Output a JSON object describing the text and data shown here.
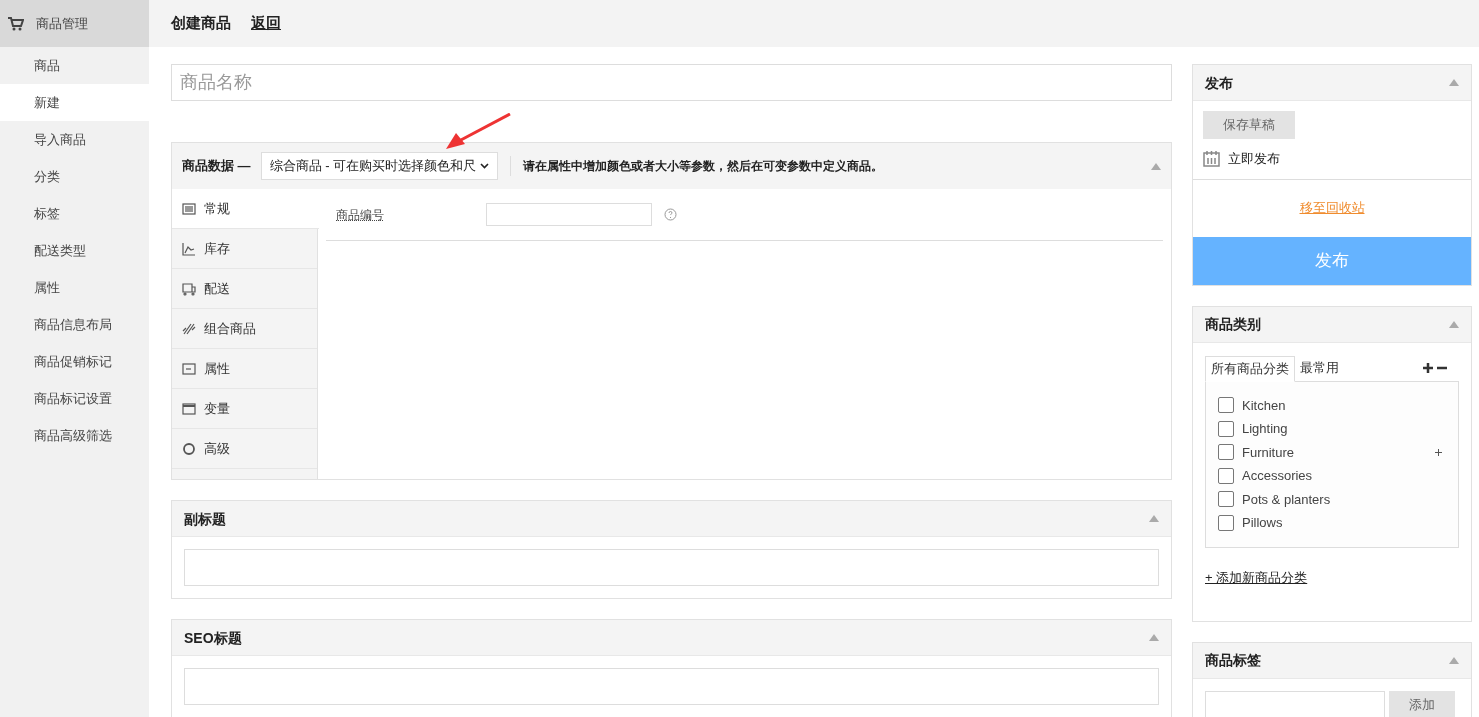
{
  "sidebar": {
    "title": "商品管理",
    "items": [
      {
        "label": "商品",
        "selected": false
      },
      {
        "label": "新建",
        "selected": true
      },
      {
        "label": "导入商品",
        "selected": false
      },
      {
        "label": "分类",
        "selected": false
      },
      {
        "label": "标签",
        "selected": false
      },
      {
        "label": "配送类型",
        "selected": false
      },
      {
        "label": "属性",
        "selected": false
      },
      {
        "label": "商品信息布局",
        "selected": false
      },
      {
        "label": "商品促销标记",
        "selected": false
      },
      {
        "label": "商品标记设置",
        "selected": false
      },
      {
        "label": "商品高级筛选",
        "selected": false
      }
    ]
  },
  "header": {
    "title": "创建商品",
    "back_link": "返回"
  },
  "name_field": {
    "placeholder": "商品名称"
  },
  "product_data": {
    "title": "商品数据 —",
    "type_select": "综合商品 - 可在购买时选择颜色和尺",
    "hint": "请在属性中增加颜色或者大小等参数，然后在可变参数中定义商品。",
    "tabs": [
      {
        "label": "常规",
        "kind": "general",
        "selected": true
      },
      {
        "label": "库存",
        "kind": "inventory",
        "selected": false
      },
      {
        "label": "配送",
        "kind": "shipping",
        "selected": false
      },
      {
        "label": "组合商品",
        "kind": "linked",
        "selected": false
      },
      {
        "label": "属性",
        "kind": "attributes",
        "selected": false
      },
      {
        "label": "变量",
        "kind": "variations",
        "selected": false
      },
      {
        "label": "高级",
        "kind": "advanced",
        "selected": false
      }
    ],
    "sku_label": "商品编号"
  },
  "subtitle_box": {
    "title": "副标题"
  },
  "seo_box": {
    "title": "SEO标题"
  },
  "publish": {
    "title": "发布",
    "save_draft": "保存草稿",
    "schedule": "立即发布",
    "trash_link": "移至回收站",
    "publish_button": "发布"
  },
  "categories": {
    "title": "商品类别",
    "tabs": [
      {
        "label": "所有商品分类",
        "selected": true
      },
      {
        "label": "最常用",
        "selected": false
      }
    ],
    "items": [
      {
        "label": "Kitchen",
        "checked": false,
        "has_children": false
      },
      {
        "label": "Lighting",
        "checked": false,
        "has_children": false
      },
      {
        "label": "Furniture",
        "checked": false,
        "has_children": true
      },
      {
        "label": "Accessories",
        "checked": false,
        "has_children": false
      },
      {
        "label": "Pots & planters",
        "checked": false,
        "has_children": false
      },
      {
        "label": "Pillows",
        "checked": false,
        "has_children": false
      }
    ],
    "add_link": "+ 添加新商品分类"
  },
  "tags": {
    "title": "商品标签",
    "add_button": "添加"
  }
}
